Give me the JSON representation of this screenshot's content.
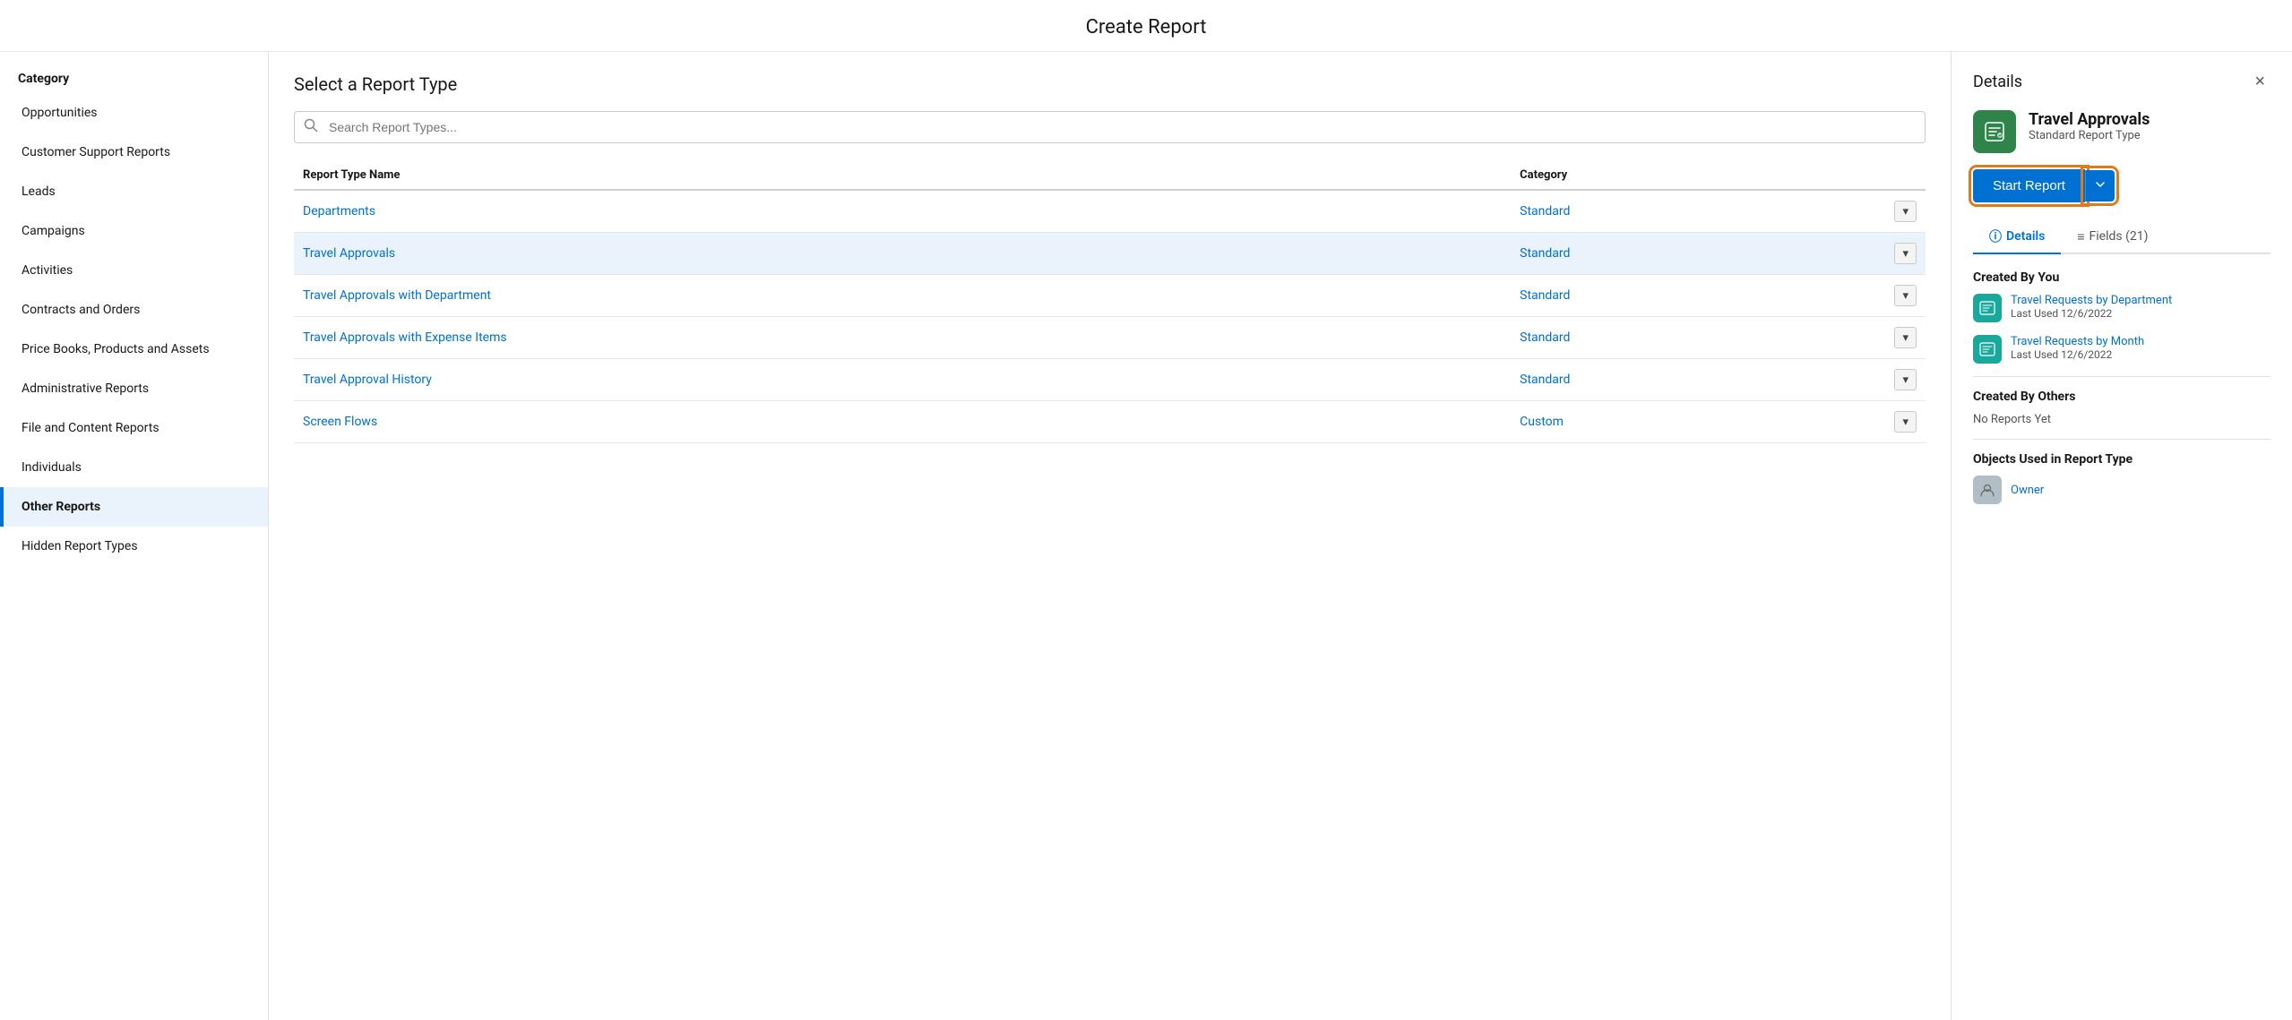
{
  "page": {
    "title": "Create Report"
  },
  "sidebar": {
    "category_label": "Category",
    "items": [
      {
        "id": "opportunities",
        "label": "Opportunities",
        "active": false
      },
      {
        "id": "customer-support",
        "label": "Customer Support Reports",
        "active": false
      },
      {
        "id": "leads",
        "label": "Leads",
        "active": false
      },
      {
        "id": "campaigns",
        "label": "Campaigns",
        "active": false
      },
      {
        "id": "activities",
        "label": "Activities",
        "active": false
      },
      {
        "id": "contracts-orders",
        "label": "Contracts and Orders",
        "active": false
      },
      {
        "id": "price-books",
        "label": "Price Books, Products and Assets",
        "active": false
      },
      {
        "id": "administrative",
        "label": "Administrative Reports",
        "active": false
      },
      {
        "id": "file-content",
        "label": "File and Content Reports",
        "active": false
      },
      {
        "id": "individuals",
        "label": "Individuals",
        "active": false
      },
      {
        "id": "other-reports",
        "label": "Other Reports",
        "active": true
      },
      {
        "id": "hidden-report-types",
        "label": "Hidden Report Types",
        "active": false
      }
    ]
  },
  "middle": {
    "heading": "Select a Report Type",
    "search_placeholder": "Search Report Types...",
    "table": {
      "col_name": "Report Type Name",
      "col_category": "Category",
      "rows": [
        {
          "id": 1,
          "name": "Departments",
          "category": "Standard",
          "selected": false
        },
        {
          "id": 2,
          "name": "Travel Approvals",
          "category": "Standard",
          "selected": true
        },
        {
          "id": 3,
          "name": "Travel Approvals with Department",
          "category": "Standard",
          "selected": false
        },
        {
          "id": 4,
          "name": "Travel Approvals with Expense Items",
          "category": "Standard",
          "selected": false
        },
        {
          "id": 5,
          "name": "Travel Approval History",
          "category": "Standard",
          "selected": false
        },
        {
          "id": 6,
          "name": "Screen Flows",
          "category": "Custom",
          "selected": false
        }
      ]
    }
  },
  "details": {
    "panel_title": "Details",
    "close_label": "×",
    "report_type_name": "Travel Approvals",
    "report_type_sub": "Standard Report Type",
    "start_report_label": "Start Report",
    "tabs": [
      {
        "id": "details",
        "label": "Details",
        "icon": "ⓘ",
        "active": true
      },
      {
        "id": "fields",
        "label": "Fields (21)",
        "icon": "≡",
        "active": false
      }
    ],
    "created_by_you_title": "Created By You",
    "created_by_you_items": [
      {
        "name": "Travel Requests by Department",
        "meta": "Last Used 12/6/2022"
      },
      {
        "name": "Travel Requests by Month",
        "meta": "Last Used 12/6/2022"
      }
    ],
    "created_by_others_title": "Created By Others",
    "created_by_others_empty": "No Reports Yet",
    "objects_used_title": "Objects Used in Report Type",
    "objects_used_items": [
      {
        "name": "Owner"
      }
    ]
  }
}
